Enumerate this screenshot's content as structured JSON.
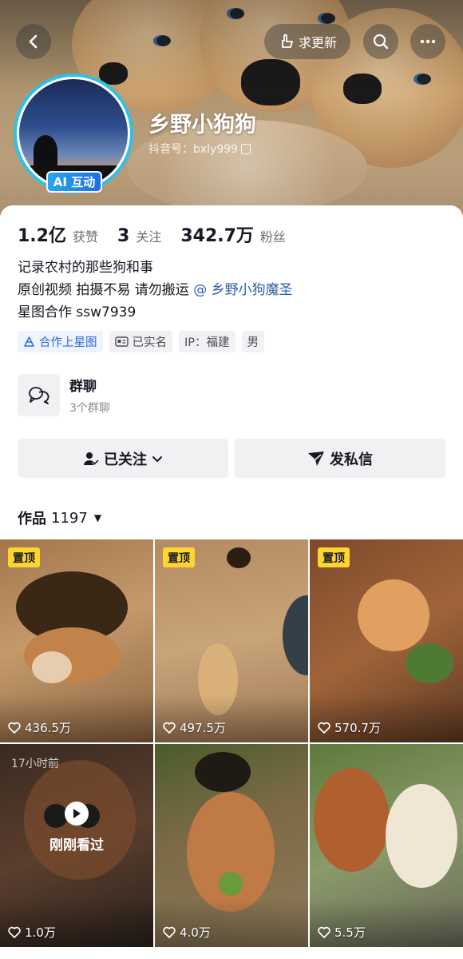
{
  "header": {
    "back_icon": "back-arrow-icon",
    "update_label": "求更新",
    "update_icon": "hand-point-icon",
    "search_icon": "search-icon",
    "more_icon": "more-dots-icon"
  },
  "profile": {
    "nickname": "乡野小狗狗",
    "douyin_id": "抖音号：bxly999",
    "ai_badge": "AI 互动",
    "ring_color": "#2cc2e6"
  },
  "stats": [
    {
      "num": "1.2亿",
      "label": "获赞"
    },
    {
      "num": "3",
      "label": "关注"
    },
    {
      "num": "342.7万",
      "label": "粉丝"
    }
  ],
  "bio": {
    "line1": "记录农村的那些狗和事",
    "line2_prefix": "原创视频 拍摄不易 请勿搬运 ",
    "line2_mention": "@ 乡野小狗魔圣",
    "line3": "星图合作 ssw7939"
  },
  "tags": [
    {
      "label": "合作上星图",
      "icon": "star-map-icon"
    },
    {
      "label": "已实名",
      "icon": "id-card-icon"
    },
    {
      "label": "IP：福建"
    },
    {
      "label": "男"
    }
  ],
  "group_chat": {
    "title": "群聊",
    "subtitle": "3个群聊",
    "icon": "chat-bubbles-icon"
  },
  "actions": {
    "follow_label": "已关注",
    "message_label": "发私信"
  },
  "works": {
    "label": "作品",
    "count": "1197"
  },
  "videos": [
    {
      "pinned": "置顶",
      "likes": "436.5万"
    },
    {
      "pinned": "置顶",
      "likes": "497.5万"
    },
    {
      "pinned": "置顶",
      "likes": "570.7万"
    },
    {
      "time_ago": "17小时前",
      "watched": "刚刚看过",
      "likes": "1.0万"
    },
    {
      "likes": "4.0万"
    },
    {
      "likes": "5.5万"
    }
  ],
  "colors": {
    "pin_yellow": "#fed52f",
    "mention_blue": "#2b5fa8",
    "tag_blue": "#2d6cd6"
  }
}
